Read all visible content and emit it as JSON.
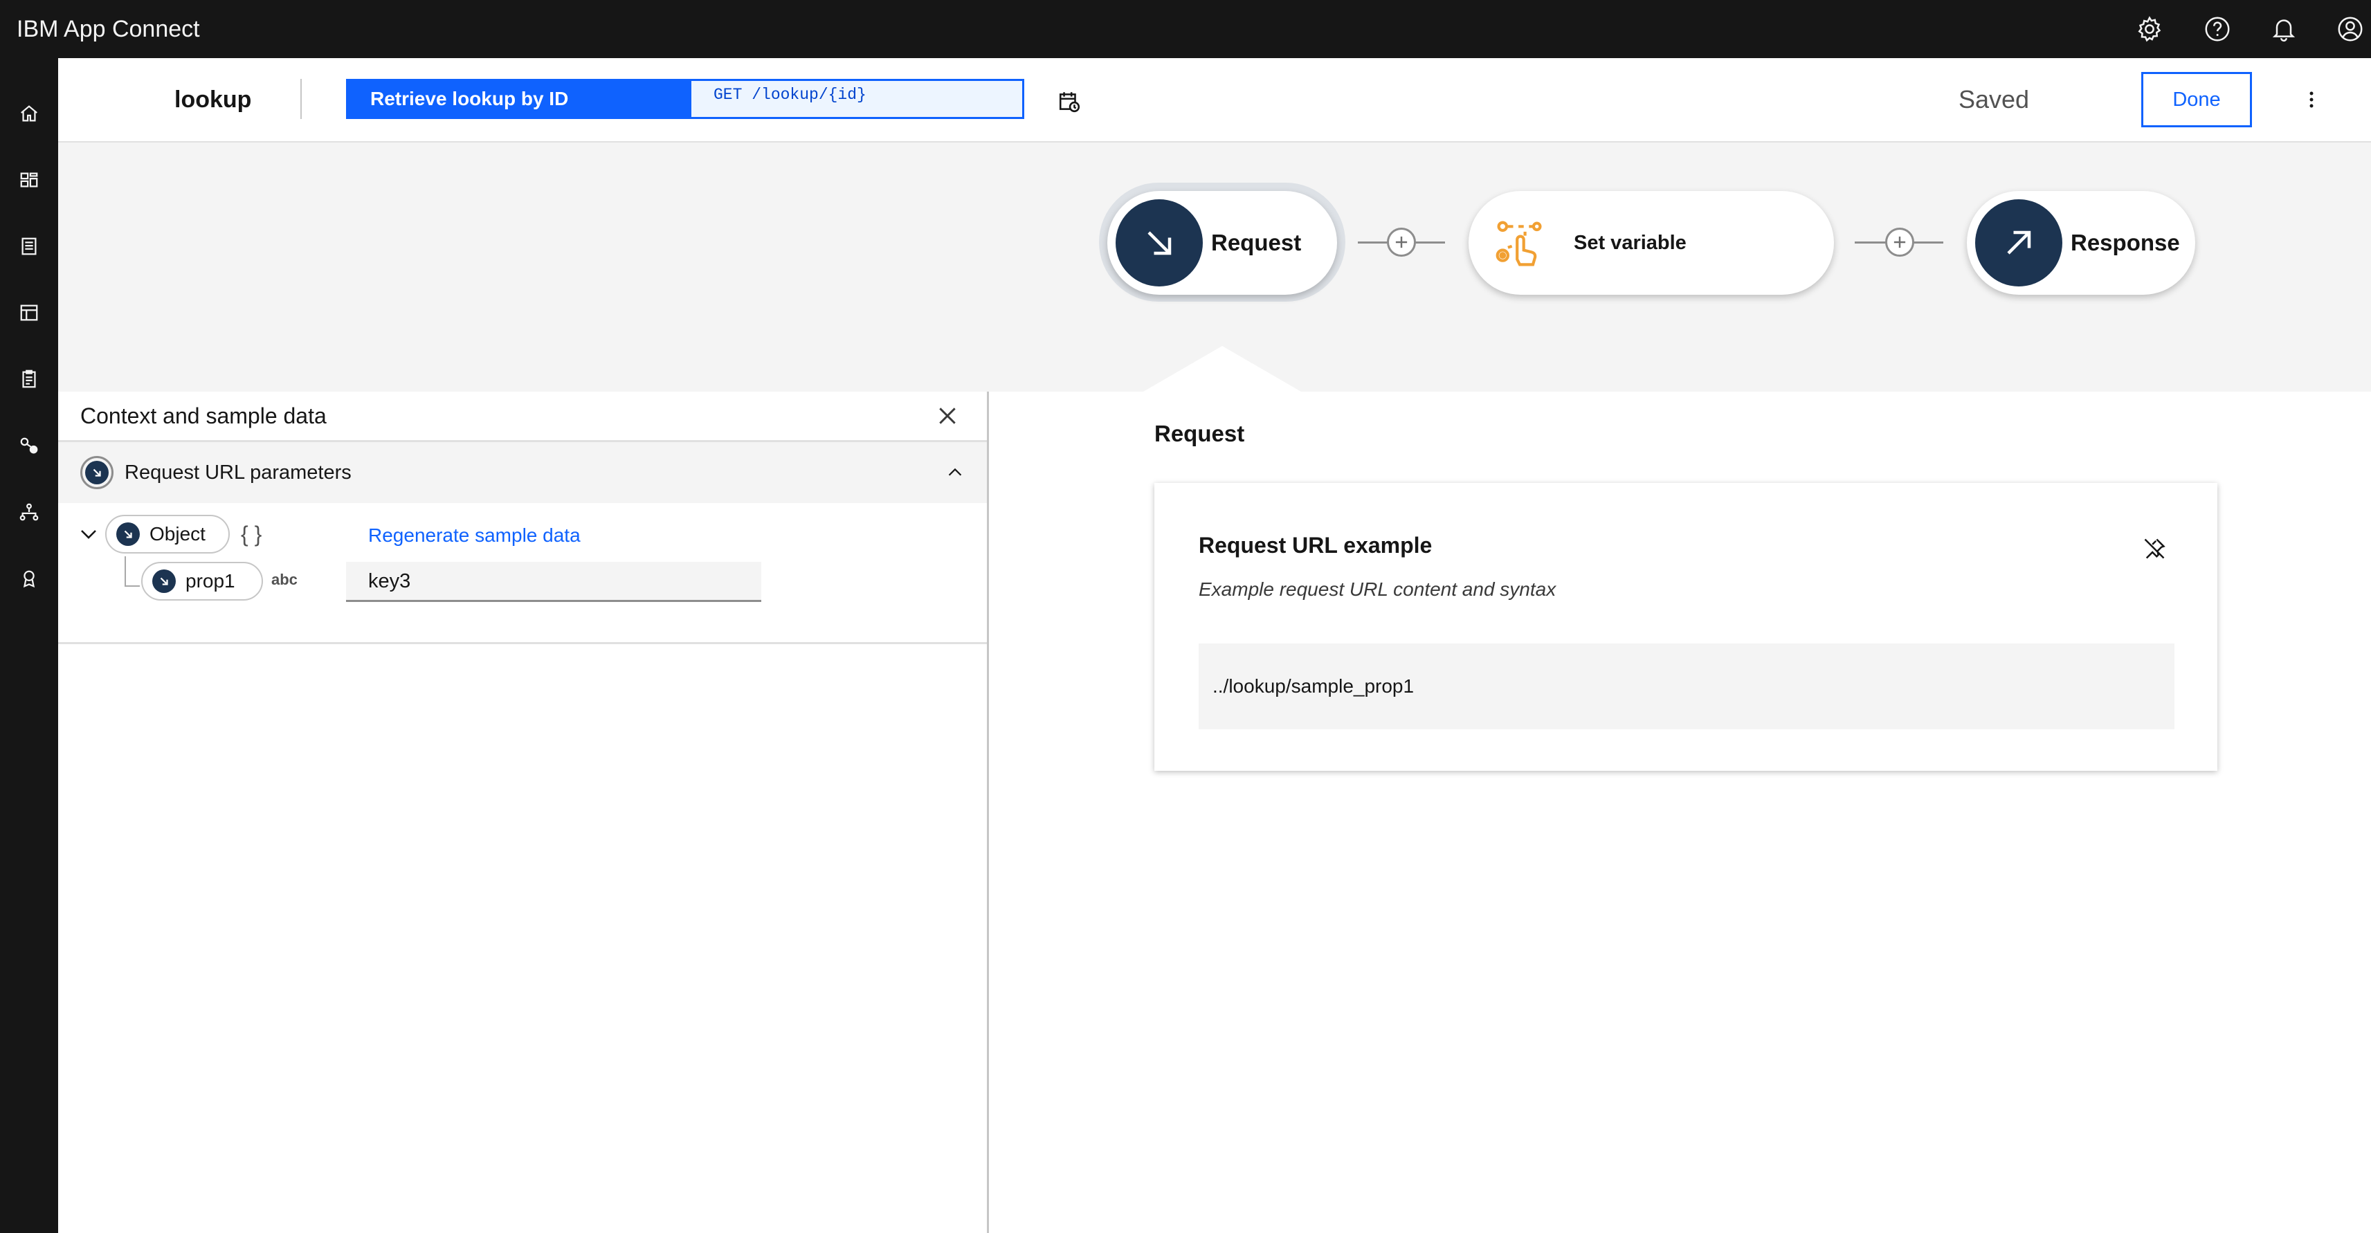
{
  "app": {
    "title": "IBM App Connect"
  },
  "header_icons": [
    "settings-icon",
    "help-icon",
    "notification-icon",
    "user-avatar-icon"
  ],
  "left_nav": [
    "home-icon",
    "dashboard-icon",
    "catalog-icon",
    "templates-icon",
    "logs-icon",
    "connectors-icon",
    "flows-icon",
    "learning-icon"
  ],
  "toolbar": {
    "flow_name": "lookup",
    "operation_label": "Retrieve lookup by ID",
    "operation_path": "GET /lookup/{id}",
    "status": "Saved",
    "done_label": "Done"
  },
  "flow": {
    "nodes": [
      {
        "label": "Request",
        "icon": "arrow-down-right-icon"
      },
      {
        "label": "Set variable",
        "icon": "set-variable-icon"
      },
      {
        "label": "Response",
        "icon": "arrow-up-right-icon"
      }
    ]
  },
  "context_panel": {
    "title": "Context and sample data",
    "section_title": "Request URL parameters",
    "root_label": "Object",
    "root_type": "{ }",
    "regenerate_label": "Regenerate sample data",
    "field_name": "prop1",
    "field_type": "abc",
    "field_value": "key3"
  },
  "detail": {
    "heading": "Request",
    "card_title": "Request URL example",
    "card_subtitle": "Example request URL content and syntax",
    "example_url": "../lookup/sample_prop1"
  },
  "colors": {
    "header_bg": "#161616",
    "primary": "#0f62fe",
    "node_dark": "#1c3451",
    "accent_orange": "#f1a033",
    "canvas_bg": "#f4f4f4"
  }
}
